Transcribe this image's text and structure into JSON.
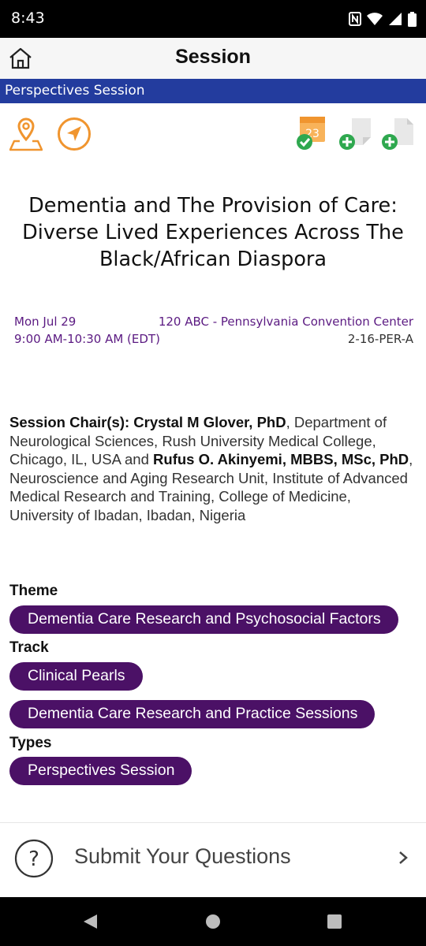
{
  "status": {
    "time": "8:43"
  },
  "appbar": {
    "title": "Session"
  },
  "category": "Perspectives Session",
  "calendar": {
    "day": "23"
  },
  "session": {
    "title_lines": [
      "Dementia and The Provision of Care:",
      "Diverse Lived Experiences Across The",
      "Black/African Diaspora"
    ],
    "date": "Mon Jul 29",
    "location": "120 ABC - Pennsylvania Convention Center",
    "time": "9:00 AM-10:30 AM (EDT)",
    "code": "2-16-PER-A"
  },
  "chairs": {
    "label": "Session Chair(s):",
    "chair1_name": "Crystal M Glover, PhD",
    "chair1_affil": ", Department of Neurological Sciences, Rush University Medical College, Chicago, IL, USA and ",
    "chair2_name": "Rufus O. Akinyemi, MBBS, MSc, PhD",
    "chair2_affil": ", Neuroscience and Aging Research Unit, Institute of Advanced Medical Research and Training, College of Medicine, University of Ibadan, Ibadan, Nigeria"
  },
  "theme": {
    "label": "Theme",
    "items": [
      "Dementia Care Research and Psychosocial Factors"
    ]
  },
  "track": {
    "label": "Track",
    "items": [
      "Clinical Pearls",
      "Dementia Care Research and Practice Sessions"
    ]
  },
  "types": {
    "label": "Types",
    "items": [
      "Perspectives Session"
    ]
  },
  "submit": {
    "label": "Submit Your Questions"
  },
  "colors": {
    "brand_blue": "#233c9e",
    "pill_purple": "#4b1166",
    "accent_orange": "#f0952f",
    "text_purple": "#5b1a82",
    "check_green": "#2fa84f"
  }
}
